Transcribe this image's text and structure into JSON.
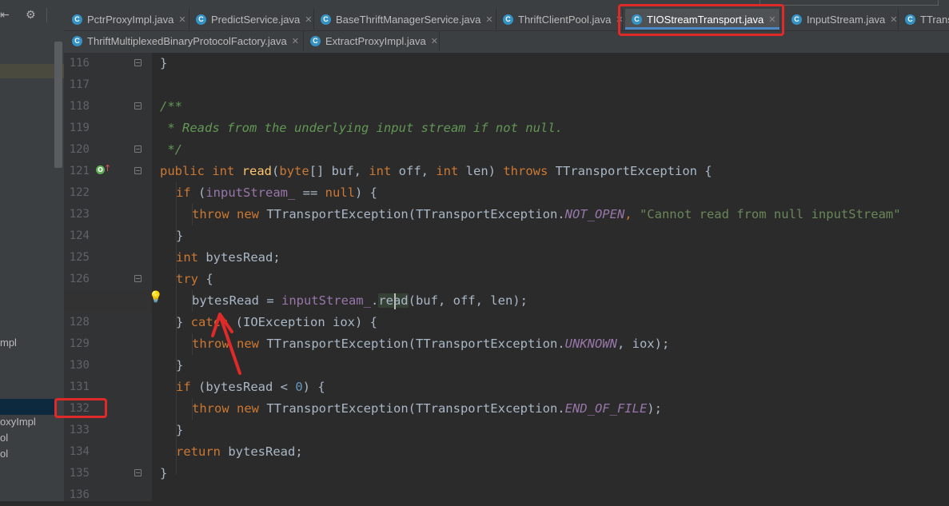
{
  "toolbar": {
    "icons": [
      "collapse-icon",
      "gear-icon"
    ]
  },
  "tabs_row1": [
    {
      "label": "PctrProxyImpl.java",
      "icon": "class-icon",
      "active": false
    },
    {
      "label": "PredictService.java",
      "icon": "class-icon",
      "active": false
    },
    {
      "label": "BaseThriftManagerService.java",
      "icon": "class-icon",
      "active": false
    },
    {
      "label": "ThriftClientPool.java",
      "icon": "class-icon",
      "active": false
    },
    {
      "label": "TIOStreamTransport.java",
      "icon": "class-icon",
      "active": true
    },
    {
      "label": "InputStream.java",
      "icon": "class-icon",
      "active": false
    },
    {
      "label": "TTrans",
      "icon": "class-icon",
      "active": false
    }
  ],
  "tabs_row2": [
    {
      "label": "ThriftMultiplexedBinaryProtocolFactory.java",
      "icon": "class-icon",
      "active": false
    },
    {
      "label": "ExtractProxyImpl.java",
      "icon": "class-icon",
      "active": false
    }
  ],
  "left_panel": {
    "items": [
      "mpl",
      "oxyImpl",
      "ol",
      "ol"
    ]
  },
  "gutter": {
    "line_numbers": [
      "116",
      "117",
      "118",
      "119",
      "120",
      "121",
      "122",
      "123",
      "124",
      "125",
      "126",
      "127",
      "128",
      "129",
      "130",
      "131",
      "132",
      "133",
      "134",
      "135",
      "136"
    ],
    "current_line": "127",
    "highlighted_line": "132"
  },
  "code": {
    "l116": "}",
    "l118": "/**",
    "l119": " * Reads from the underlying input stream if not null.",
    "l120": " */",
    "l121": {
      "kw1": "public",
      "kw2": "int",
      "fn": "read",
      "p1": "(",
      "kw3": "byte",
      "p2": "[] buf, ",
      "kw4": "int",
      "p3": " off, ",
      "kw5": "int",
      "p4": " len) ",
      "kw6": "throws",
      "p5": " TTransportException {"
    },
    "l122": {
      "kw1": "if",
      "p1": " (",
      "fld": "inputStream_",
      "p2": " == ",
      "kw2": "null",
      "p3": ") {"
    },
    "l123": {
      "kw1": "throw",
      "kw2": "new",
      "p1": " TTransportException(TTransportException.",
      "cst": "NOT_OPEN",
      "p2": ", ",
      "str": "\"Cannot read from null inputStream\""
    },
    "l124": "}",
    "l125": {
      "kw": "int",
      "p": " bytesRead;"
    },
    "l126": {
      "kw": "try",
      "p": " {"
    },
    "l127": {
      "p1": "bytesRead = ",
      "fld": "inputStream_",
      "p2": ".",
      "sel": "read",
      "p3": "(buf, off, len);"
    },
    "l128": {
      "p1": "} ",
      "kw": "catch",
      "p2": " (IOException iox) {"
    },
    "l129": {
      "kw1": "throw",
      "kw2": "new",
      "p1": " TTransportException(TTransportException.",
      "cst": "UNKNOWN",
      "p2": ", iox);"
    },
    "l130": "}",
    "l131": {
      "kw": "if",
      "p1": " (bytesRead < ",
      "num": "0",
      "p2": ") {"
    },
    "l132": {
      "kw1": "throw",
      "kw2": "new",
      "p1": " TTransportException(TTransportException.",
      "cst": "END_OF_FILE",
      "p2": ");"
    },
    "l133": "}",
    "l134": {
      "kw": "return",
      "p": " bytesRead;"
    },
    "l135": "}"
  },
  "colors": {
    "keyword": "#cc7832",
    "comment": "#629755",
    "string": "#6a8759",
    "field": "#9876aa",
    "annotation_red": "#e02929"
  }
}
